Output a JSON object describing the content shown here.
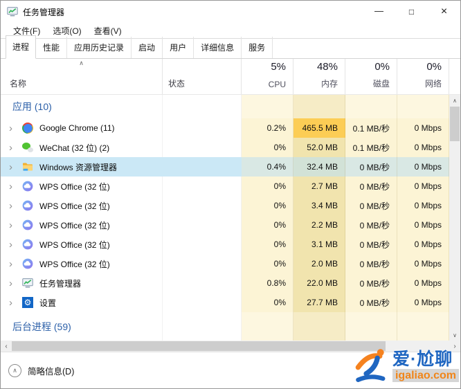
{
  "window": {
    "title": "任务管理器"
  },
  "icons": {
    "minimize": "—",
    "maximize": "□",
    "close": "×",
    "row_chevron": "›",
    "sort_ascending": "∧",
    "scroll_up": "∧",
    "scroll_down": "∨",
    "scroll_left": "‹",
    "scroll_right": "›",
    "more_less_toggle": "∧",
    "settings_gear": "⚙"
  },
  "menu": {
    "items": [
      "文件(F)",
      "选项(O)",
      "查看(V)"
    ]
  },
  "tabs": {
    "items": [
      "进程",
      "性能",
      "应用历史记录",
      "启动",
      "用户",
      "详细信息",
      "服务"
    ],
    "active": "进程"
  },
  "table": {
    "name_header": "名称",
    "status_header": "状态",
    "metric_headers": [
      {
        "value": "5%",
        "label": "CPU"
      },
      {
        "value": "48%",
        "label": "内存"
      },
      {
        "value": "0%",
        "label": "磁盘"
      },
      {
        "value": "0%",
        "label": "网络"
      }
    ],
    "rows": [
      {
        "type": "group",
        "name": "应用 (10)"
      },
      {
        "type": "process",
        "icon": "chrome",
        "name": "Google Chrome (11)",
        "cpu": "0.2%",
        "memory": "465.5 MB",
        "disk": "0.1 MB/秒",
        "network": "0 Mbps",
        "memory_heat": "hot"
      },
      {
        "type": "process",
        "icon": "wechat",
        "name": "WeChat (32 位) (2)",
        "cpu": "0%",
        "memory": "52.0 MB",
        "disk": "0.1 MB/秒",
        "network": "0 Mbps"
      },
      {
        "type": "process",
        "icon": "explorer",
        "name": "Windows 资源管理器",
        "cpu": "0.4%",
        "memory": "32.4 MB",
        "disk": "0 MB/秒",
        "network": "0 Mbps",
        "selected": true
      },
      {
        "type": "process",
        "icon": "wps",
        "name": "WPS Office (32 位)",
        "cpu": "0%",
        "memory": "2.7 MB",
        "disk": "0 MB/秒",
        "network": "0 Mbps"
      },
      {
        "type": "process",
        "icon": "wps",
        "name": "WPS Office (32 位)",
        "cpu": "0%",
        "memory": "3.4 MB",
        "disk": "0 MB/秒",
        "network": "0 Mbps"
      },
      {
        "type": "process",
        "icon": "wps",
        "name": "WPS Office (32 位)",
        "cpu": "0%",
        "memory": "2.2 MB",
        "disk": "0 MB/秒",
        "network": "0 Mbps"
      },
      {
        "type": "process",
        "icon": "wps",
        "name": "WPS Office (32 位)",
        "cpu": "0%",
        "memory": "3.1 MB",
        "disk": "0 MB/秒",
        "network": "0 Mbps"
      },
      {
        "type": "process",
        "icon": "wps",
        "name": "WPS Office (32 位)",
        "cpu": "0%",
        "memory": "2.0 MB",
        "disk": "0 MB/秒",
        "network": "0 Mbps"
      },
      {
        "type": "process",
        "icon": "taskmgr",
        "name": "任务管理器",
        "cpu": "0.8%",
        "memory": "22.0 MB",
        "disk": "0 MB/秒",
        "network": "0 Mbps"
      },
      {
        "type": "process",
        "icon": "settings",
        "name": "设置",
        "cpu": "0%",
        "memory": "27.7 MB",
        "disk": "0 MB/秒",
        "network": "0 Mbps"
      },
      {
        "type": "group",
        "name": "后台进程 (59)",
        "spacer_before": true
      }
    ]
  },
  "footer": {
    "toggle_label": "简略信息(D)"
  },
  "watermark": {
    "brand": "爱·尬聊",
    "domain": "igaliao.com"
  },
  "colors": {
    "selection_bg": "#cbe8f6",
    "group_header_text": "#2b5fa8",
    "heat_light": "#fcf4d5",
    "heat_memory": "#f1e4ae",
    "heat_hot": "#fccd55",
    "brand_blue": "#1f66c1",
    "brand_orange": "#f08519"
  }
}
